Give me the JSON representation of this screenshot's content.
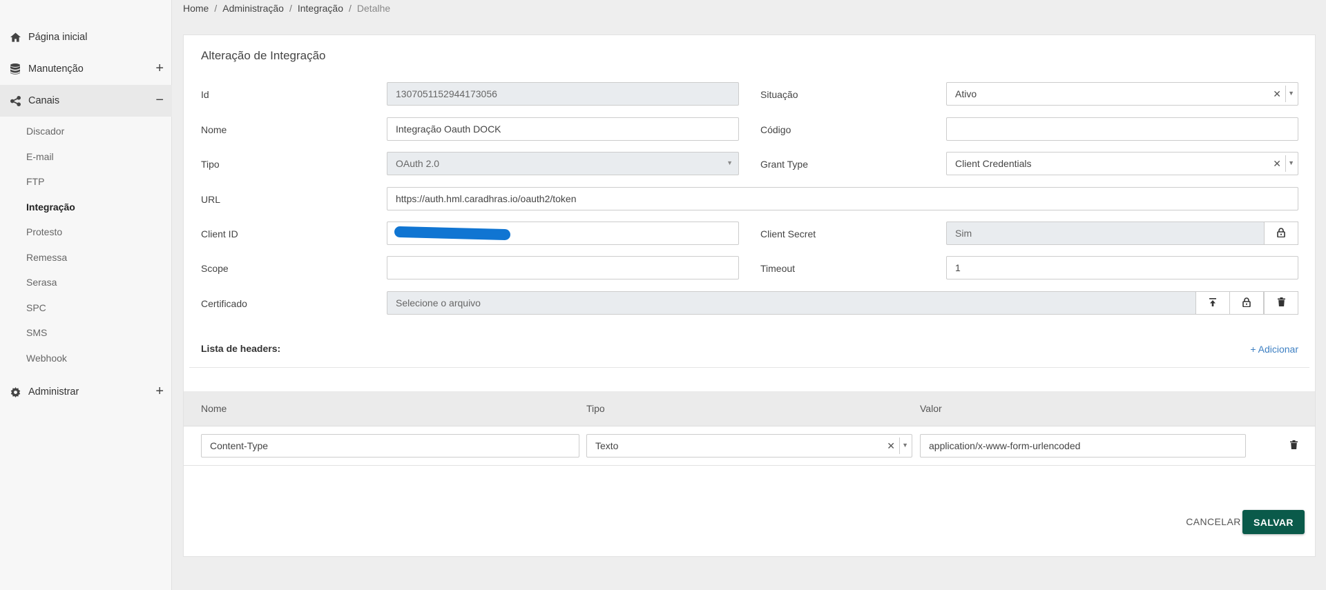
{
  "sidebar": {
    "home": {
      "label": "Página inicial",
      "icon": "home-icon"
    },
    "manutencao": {
      "label": "Manutenção",
      "icon": "database-icon",
      "toggle": "+"
    },
    "canais": {
      "label": "Canais",
      "icon": "share-icon",
      "toggle": "−"
    },
    "canais_items": [
      "Discador",
      "E-mail",
      "FTP",
      "Integração",
      "Protesto",
      "Remessa",
      "Serasa",
      "SPC",
      "SMS",
      "Webhook"
    ],
    "current_item": "Integração",
    "administrar": {
      "label": "Administrar",
      "icon": "gear-icon",
      "toggle": "+"
    }
  },
  "breadcrumb": {
    "items": [
      "Home",
      "Administração",
      "Integração"
    ],
    "current": "Detalhe",
    "separator": "/"
  },
  "form": {
    "title": "Alteração de Integração",
    "id": {
      "label": "Id",
      "value": "1307051152944173056"
    },
    "situacao": {
      "label": "Situação",
      "value": "Ativo"
    },
    "nome": {
      "label": "Nome",
      "value": "Integração Oauth DOCK"
    },
    "codigo": {
      "label": "Código",
      "value": ""
    },
    "tipo": {
      "label": "Tipo",
      "value": "OAuth 2.0"
    },
    "grant_type": {
      "label": "Grant Type",
      "value": "Client Credentials"
    },
    "url": {
      "label": "URL",
      "value": "https://auth.hml.caradhras.io/oauth2/token"
    },
    "client_id": {
      "label": "Client ID",
      "value": ""
    },
    "client_secret": {
      "label": "Client Secret",
      "value": "Sim"
    },
    "scope": {
      "label": "Scope",
      "value": ""
    },
    "timeout": {
      "label": "Timeout",
      "value": "1"
    },
    "certificado": {
      "label": "Certificado",
      "placeholder": "Selecione o arquivo"
    }
  },
  "headers": {
    "title": "Lista de headers:",
    "add_label": "+ Adicionar",
    "columns": [
      "Nome",
      "Tipo",
      "Valor"
    ],
    "rows": [
      {
        "nome": "Content-Type",
        "tipo": "Texto",
        "valor": "application/x-www-form-urlencoded"
      }
    ]
  },
  "actions": {
    "cancel": "CANCELAR",
    "save": "SALVAR"
  },
  "colors": {
    "primary": "#0a5a4a",
    "link": "#3d7fc2",
    "redaction": "#1075d2"
  }
}
